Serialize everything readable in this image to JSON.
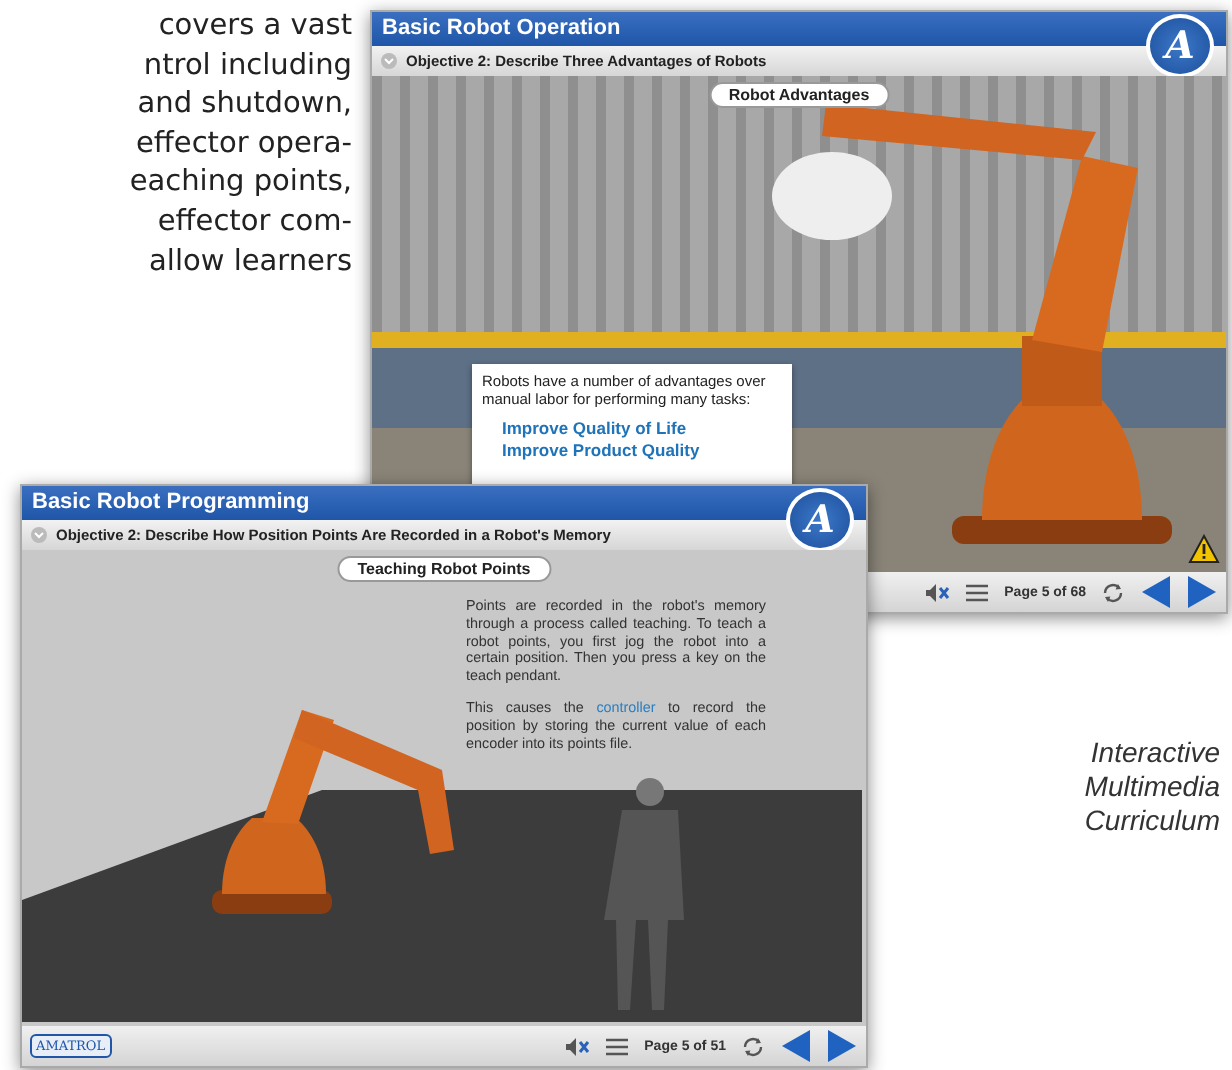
{
  "brochure_text": {
    "lines": [
      "covers a vast",
      "ntrol including",
      "and shutdown,",
      "effector opera-",
      "eaching points,",
      "effector com-",
      "allow learners"
    ]
  },
  "back_window": {
    "title": "Basic Robot Operation",
    "logo": "A",
    "objective": "Objective 2: Describe Three Advantages of Robots",
    "scene_label": "Robot Advantages",
    "text_box": {
      "intro": "Robots have a number of advantages over manual labor for performing many tasks:",
      "links": [
        "Improve Quality of Life",
        "Improve Product Quality"
      ]
    },
    "page": "Page 5 of 68"
  },
  "front_window": {
    "title": "Basic Robot Programming",
    "logo": "A",
    "objective": "Objective 2: Describe How Position Points Are Recorded in a Robot's Memory",
    "scene_label": "Teaching Robot Points",
    "paragraphs": [
      {
        "text": "Points are recorded in the robot's memory through a process called teaching. To teach a robot points, you first jog the robot into a certain position. Then you press a key on the teach pendant."
      },
      {
        "before": "This causes the ",
        "link": "controller",
        "after": " to record the position by storing the current value of each encoder into its points file."
      }
    ],
    "brand": "AMATROL",
    "page": "Page 5 of 51"
  },
  "caption": {
    "lines": [
      "Interactive",
      "Multimedia",
      "Curriculum"
    ]
  }
}
